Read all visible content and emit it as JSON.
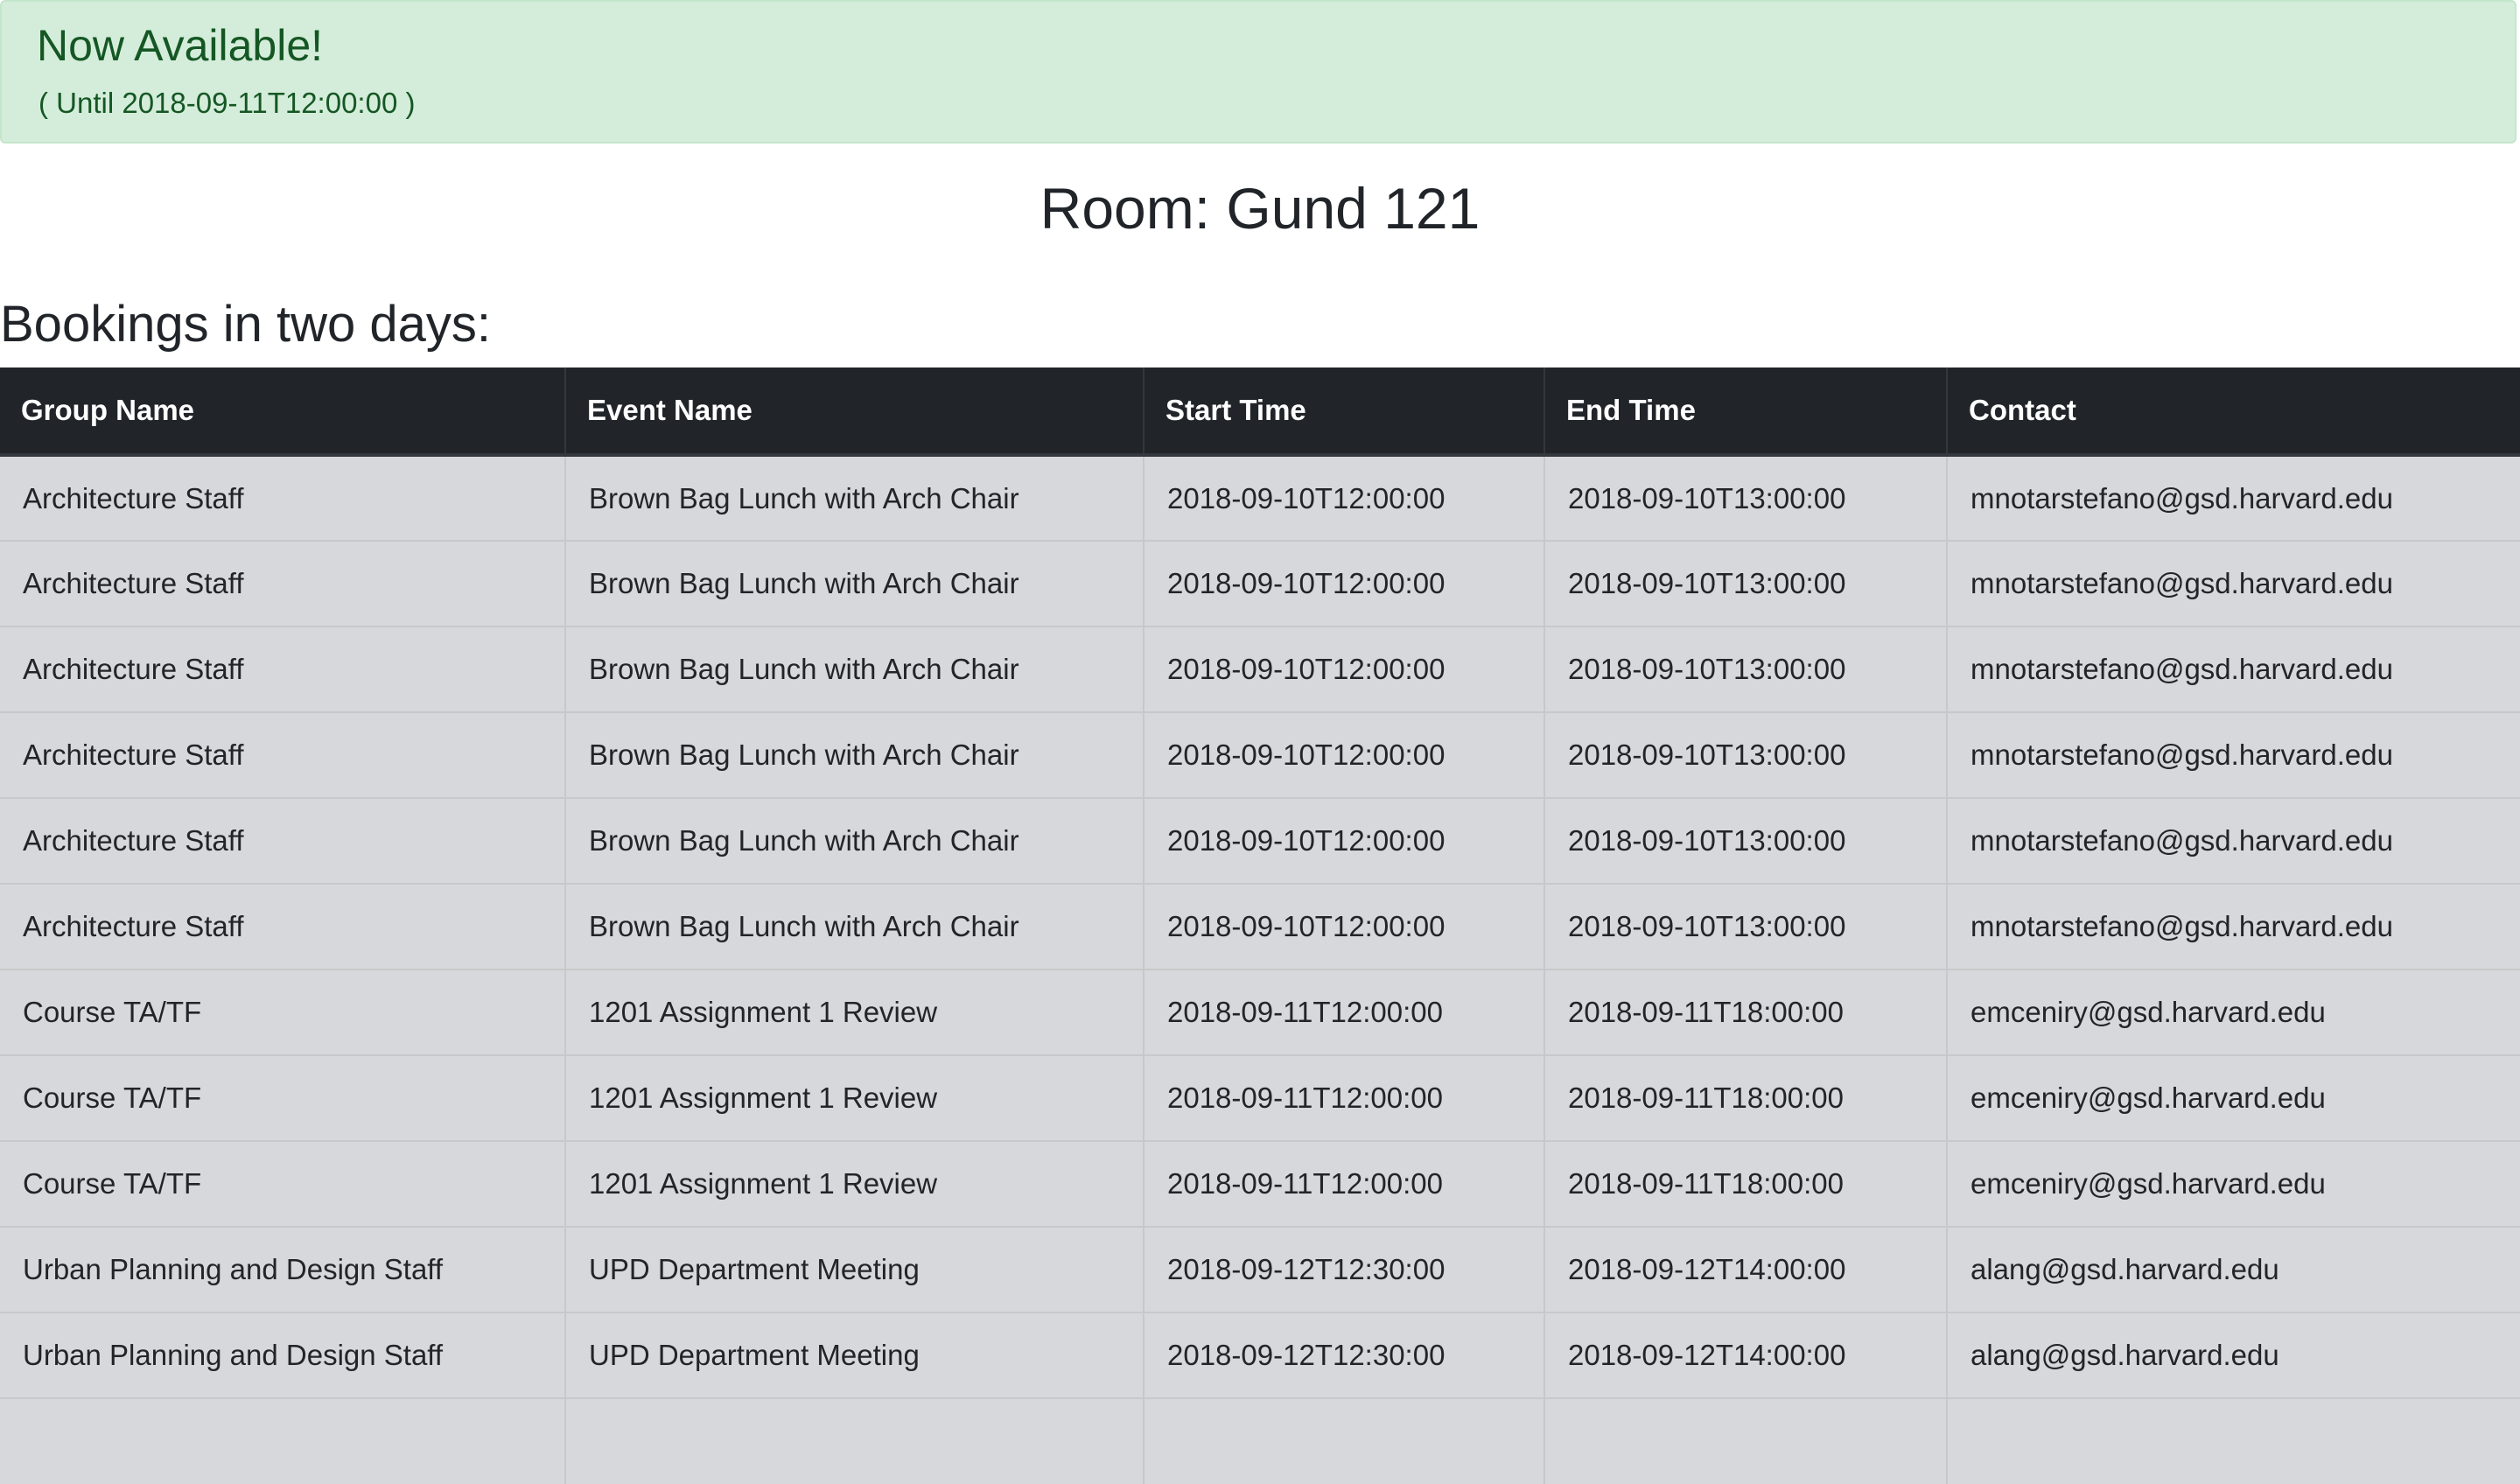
{
  "alert": {
    "title": "Now Available!",
    "subtitle": "( Until 2018-09-11T12:00:00 )",
    "background": "#d4edda",
    "text_color": "#155724"
  },
  "room": {
    "title": "Room: Gund 121"
  },
  "bookings": {
    "heading": "Bookings in two days:",
    "header_color": "#212529",
    "row_color": "#d6d8db",
    "columns": [
      "Group Name",
      "Event Name",
      "Start Time",
      "End Time",
      "Contact"
    ],
    "rows": [
      [
        "Architecture Staff",
        "Brown Bag Lunch with Arch Chair",
        "2018-09-10T12:00:00",
        "2018-09-10T13:00:00",
        "mnotarstefano@gsd.harvard.edu"
      ],
      [
        "Architecture Staff",
        "Brown Bag Lunch with Arch Chair",
        "2018-09-10T12:00:00",
        "2018-09-10T13:00:00",
        "mnotarstefano@gsd.harvard.edu"
      ],
      [
        "Architecture Staff",
        "Brown Bag Lunch with Arch Chair",
        "2018-09-10T12:00:00",
        "2018-09-10T13:00:00",
        "mnotarstefano@gsd.harvard.edu"
      ],
      [
        "Architecture Staff",
        "Brown Bag Lunch with Arch Chair",
        "2018-09-10T12:00:00",
        "2018-09-10T13:00:00",
        "mnotarstefano@gsd.harvard.edu"
      ],
      [
        "Architecture Staff",
        "Brown Bag Lunch with Arch Chair",
        "2018-09-10T12:00:00",
        "2018-09-10T13:00:00",
        "mnotarstefano@gsd.harvard.edu"
      ],
      [
        "Architecture Staff",
        "Brown Bag Lunch with Arch Chair",
        "2018-09-10T12:00:00",
        "2018-09-10T13:00:00",
        "mnotarstefano@gsd.harvard.edu"
      ],
      [
        "Course TA/TF",
        "1201 Assignment 1 Review",
        "2018-09-11T12:00:00",
        "2018-09-11T18:00:00",
        "emceniry@gsd.harvard.edu"
      ],
      [
        "Course TA/TF",
        "1201 Assignment 1 Review",
        "2018-09-11T12:00:00",
        "2018-09-11T18:00:00",
        "emceniry@gsd.harvard.edu"
      ],
      [
        "Course TA/TF",
        "1201 Assignment 1 Review",
        "2018-09-11T12:00:00",
        "2018-09-11T18:00:00",
        "emceniry@gsd.harvard.edu"
      ],
      [
        "Urban Planning and Design Staff",
        "UPD Department Meeting",
        "2018-09-12T12:30:00",
        "2018-09-12T14:00:00",
        "alang@gsd.harvard.edu"
      ],
      [
        "Urban Planning and Design Staff",
        "UPD Department Meeting",
        "2018-09-12T12:30:00",
        "2018-09-12T14:00:00",
        "alang@gsd.harvard.edu"
      ],
      [
        "",
        "",
        "",
        "",
        ""
      ]
    ]
  }
}
